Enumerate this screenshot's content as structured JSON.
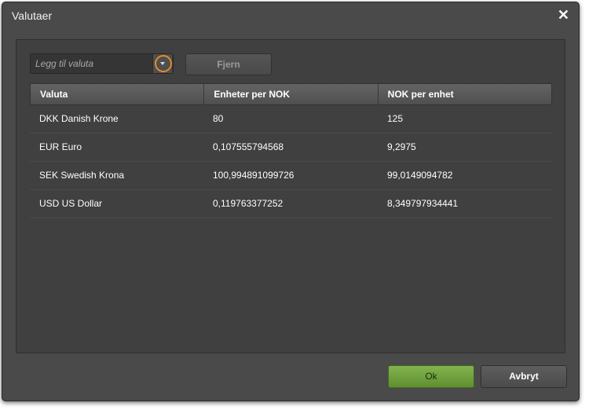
{
  "dialog": {
    "title": "Valutaer",
    "close_symbol": "✕"
  },
  "toolbar": {
    "add_placeholder": "Legg til valuta",
    "remove_label": "Fjern"
  },
  "table": {
    "headers": [
      "Valuta",
      "Enheter per NOK",
      "NOK per enhet"
    ],
    "rows": [
      [
        "DKK Danish Krone",
        "80",
        "125"
      ],
      [
        "EUR Euro",
        "0,107555794568",
        "9,2975"
      ],
      [
        "SEK Swedish Krona",
        "100,994891099726",
        "99,0149094782"
      ],
      [
        "USD US Dollar",
        "0,119763377252",
        "8,349797934441"
      ]
    ]
  },
  "footer": {
    "ok_label": "Ok",
    "cancel_label": "Avbryt"
  },
  "colors": {
    "dialog_bg": "#4a4a4a",
    "panel_bg": "#404040",
    "accent_ring": "#e8892c",
    "ok_green": "#6e9e3e"
  }
}
